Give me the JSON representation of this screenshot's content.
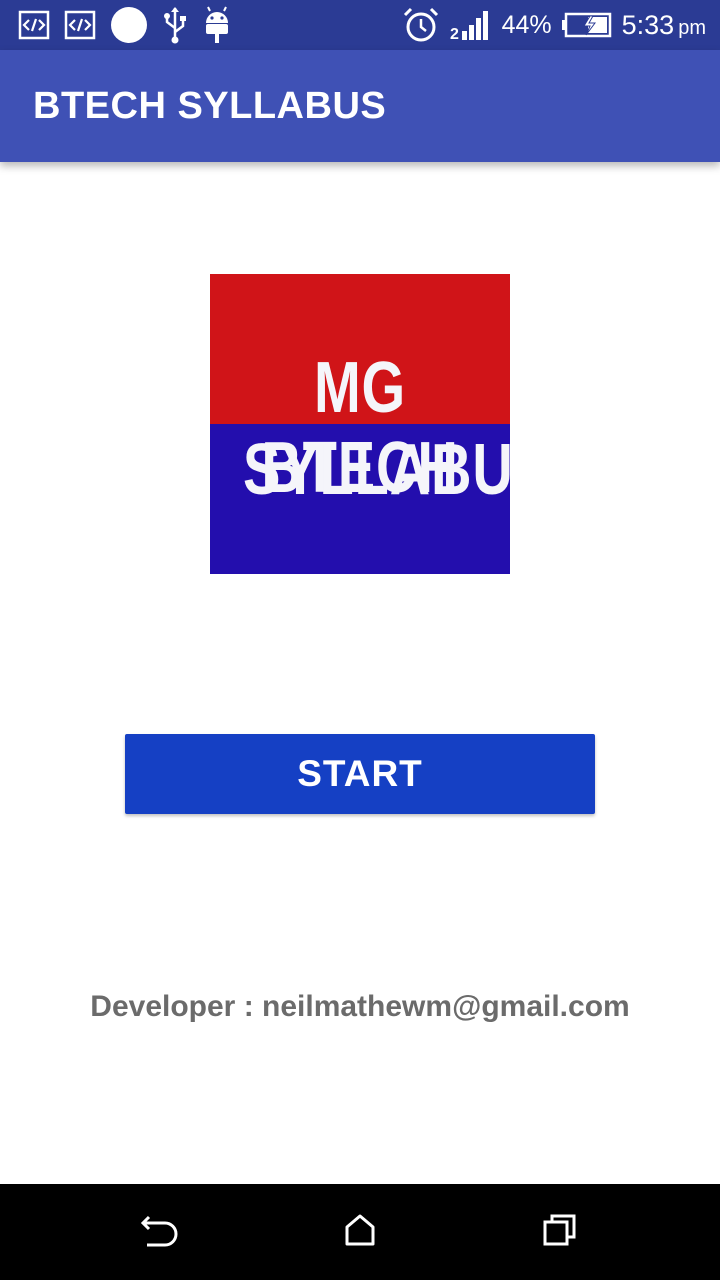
{
  "status_bar": {
    "icons_left": [
      "code-icon",
      "code-icon",
      "circle-icon",
      "usb-icon",
      "android-icon"
    ],
    "icons_right": [
      "alarm-icon",
      "signal-icon",
      "battery-charging-icon"
    ],
    "battery": "44%",
    "time": "5:33",
    "ampm": "pm"
  },
  "app_bar": {
    "title": "BTECH SYLLABUS"
  },
  "logo": {
    "line1": "MG BTECH",
    "line2": "SYLLABUS",
    "top_color": "#d01418",
    "bottom_color": "#230ead"
  },
  "main": {
    "start_label": "START",
    "developer": "Developer : neilmathewm@gmail.com"
  },
  "colors": {
    "status_bar": "#2b3b94",
    "app_bar": "#3f51b5",
    "button": "#1540c4"
  },
  "nav_bar": {
    "icons": [
      "back-icon",
      "home-icon",
      "recents-icon"
    ]
  }
}
